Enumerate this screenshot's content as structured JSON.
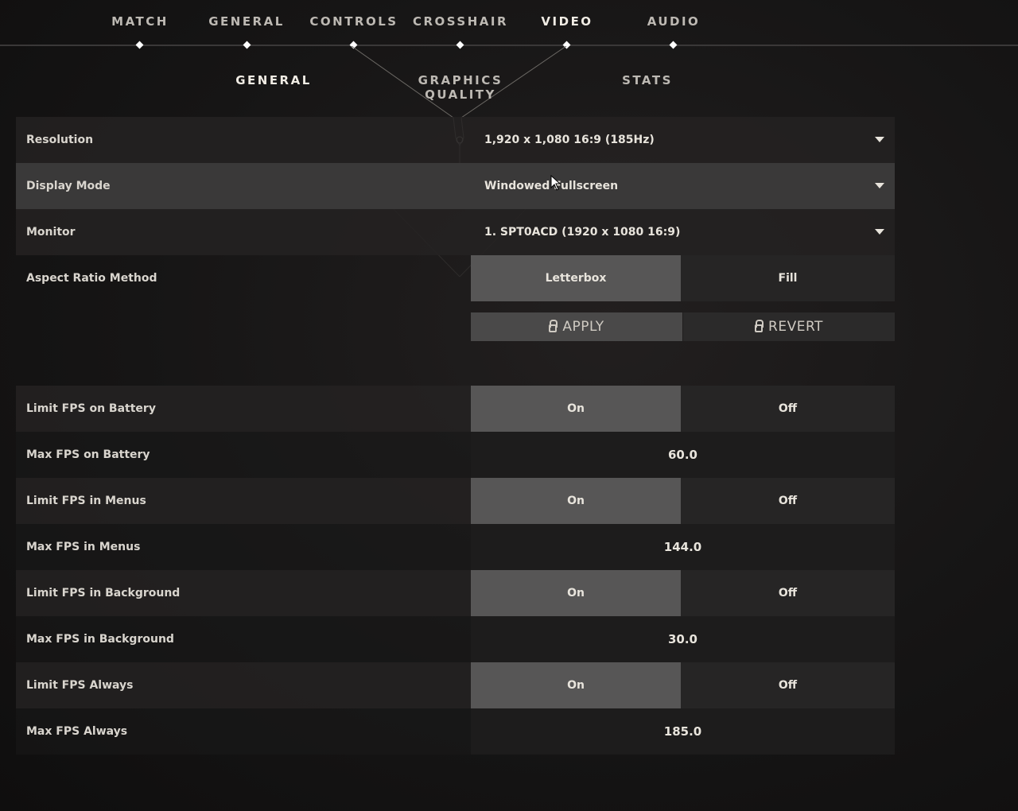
{
  "top_nav": {
    "items": [
      {
        "label": "MATCH"
      },
      {
        "label": "GENERAL"
      },
      {
        "label": "CONTROLS"
      },
      {
        "label": "CROSSHAIR"
      },
      {
        "label": "VIDEO"
      },
      {
        "label": "AUDIO"
      }
    ],
    "active": "VIDEO"
  },
  "sub_nav": {
    "items": [
      {
        "label": "GENERAL"
      },
      {
        "label": "GRAPHICS QUALITY"
      },
      {
        "label": "STATS"
      }
    ],
    "active": "GENERAL"
  },
  "settings": {
    "resolution": {
      "label": "Resolution",
      "value": "1,920 x 1,080 16:9 (185Hz)",
      "icon": "caret-down-icon"
    },
    "display_mode": {
      "label": "Display Mode",
      "value": "Windowed Fullscreen",
      "icon": "caret-down-icon"
    },
    "monitor": {
      "label": "Monitor",
      "value": "1. SPT0ACD (1920 x  1080 16:9)",
      "icon": "caret-down-icon"
    },
    "aspect_ratio": {
      "label": "Aspect Ratio Method",
      "options": [
        "Letterbox",
        "Fill"
      ],
      "selected": "Letterbox"
    },
    "limit_fps_battery": {
      "label": "Limit FPS on Battery",
      "options": [
        "On",
        "Off"
      ],
      "selected": "On"
    },
    "max_fps_battery": {
      "label": "Max FPS on Battery",
      "value": "60.0"
    },
    "limit_fps_menus": {
      "label": "Limit FPS in Menus",
      "options": [
        "On",
        "Off"
      ],
      "selected": "On"
    },
    "max_fps_menus": {
      "label": "Max FPS in Menus",
      "value": "144.0"
    },
    "limit_fps_background": {
      "label": "Limit FPS in Background",
      "options": [
        "On",
        "Off"
      ],
      "selected": "On"
    },
    "max_fps_background": {
      "label": "Max FPS in Background",
      "value": "30.0"
    },
    "limit_fps_always": {
      "label": "Limit FPS Always",
      "options": [
        "On",
        "Off"
      ],
      "selected": "On"
    },
    "max_fps_always": {
      "label": "Max FPS Always",
      "value": "185.0"
    }
  },
  "actions": {
    "apply_label": "APPLY",
    "revert_label": "REVERT",
    "icon": "lock-icon"
  },
  "colors": {
    "background": "#141313",
    "selected_toggle": "#575656",
    "highlight_row": "#3a3939",
    "text": "#ece8e1"
  }
}
